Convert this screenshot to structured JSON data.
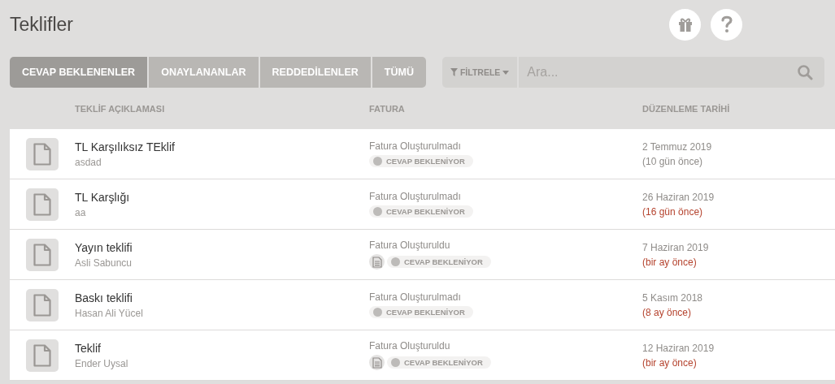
{
  "page_title": "Teklifler",
  "tabs": [
    {
      "label": "CEVAP BEKLENENLER",
      "selected": true
    },
    {
      "label": "ONAYLANANLAR",
      "selected": false
    },
    {
      "label": "REDDEDİLENLER",
      "selected": false
    },
    {
      "label": "TÜMÜ",
      "selected": false
    }
  ],
  "filter_button": "FİLTRELE",
  "search": {
    "placeholder": "Ara..."
  },
  "columns": [
    "TEKLİF AÇIKLAMASI",
    "FATURA",
    "DÜZENLEME TARİHİ"
  ],
  "rows": [
    {
      "title": "TL Karşılıksız TEklif",
      "subtitle": "asdad",
      "invoice": "Fatura Oluşturulmadı",
      "has_document": false,
      "status": "CEVAP BEKLENİYOR",
      "date": "2 Temmuz 2019",
      "ago": "(10 gün önce)",
      "overdue": false
    },
    {
      "title": "TL Karşlığı",
      "subtitle": "aa",
      "invoice": "Fatura Oluşturulmadı",
      "has_document": false,
      "status": "CEVAP BEKLENİYOR",
      "date": "26 Haziran 2019",
      "ago": "(16 gün önce)",
      "overdue": true
    },
    {
      "title": "Yayın teklifi",
      "subtitle": "Asli Sabuncu",
      "invoice": "Fatura Oluşturuldu",
      "has_document": true,
      "status": "CEVAP BEKLENİYOR",
      "date": "7 Haziran 2019",
      "ago": "(bir ay önce)",
      "overdue": true
    },
    {
      "title": "Baskı teklifi",
      "subtitle": "Hasan Ali Yücel",
      "invoice": "Fatura Oluşturulmadı",
      "has_document": false,
      "status": "CEVAP BEKLENİYOR",
      "date": "5 Kasım 2018",
      "ago": "(8 ay önce)",
      "overdue": true
    },
    {
      "title": "Teklif",
      "subtitle": "Ender Uysal",
      "invoice": "Fatura Oluşturuldu",
      "has_document": true,
      "status": "CEVAP BEKLENİYOR",
      "date": "12 Haziran 2019",
      "ago": "(bir ay önce)",
      "overdue": true
    }
  ]
}
